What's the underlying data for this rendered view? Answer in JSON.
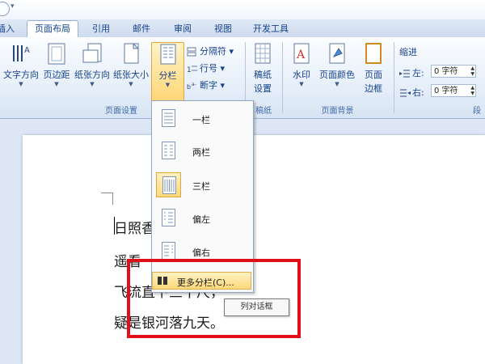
{
  "ribbon_tabs": [
    {
      "label": "插入",
      "active": false
    },
    {
      "label": "页面布局",
      "active": true
    },
    {
      "label": "引用",
      "active": false
    },
    {
      "label": "邮件",
      "active": false
    },
    {
      "label": "审阅",
      "active": false
    },
    {
      "label": "视图",
      "active": false
    },
    {
      "label": "开发工具",
      "active": false
    }
  ],
  "page_setup": {
    "text_direction": "文字方向",
    "margins": "页边距",
    "orientation": "纸张方向",
    "size": "纸张大小",
    "columns": "分栏",
    "breaks": "分隔符",
    "line_numbers": "行号",
    "hyphenation": "断字",
    "group_label": "页面设置"
  },
  "draft": {
    "label_line1": "稿纸",
    "label_line2": "设置",
    "group_label": "稿纸"
  },
  "page_background": {
    "watermark": "水印",
    "page_color": "页面颜色",
    "page_borders_line1": "页面",
    "page_borders_line2": "边框",
    "group_label": "页面背景"
  },
  "indent": {
    "title": "缩进",
    "left_label": "左:",
    "left_value": "0 字符",
    "right_label": "右:",
    "right_value": "0 字符",
    "group_label_partial": "段"
  },
  "columns_menu": {
    "items": [
      {
        "label": "一栏",
        "selected": false
      },
      {
        "label": "两栏",
        "selected": false
      },
      {
        "label": "三栏",
        "selected": true
      },
      {
        "label": "偏左",
        "selected": false
      },
      {
        "label": "偏右",
        "selected": false
      }
    ],
    "more_columns": "更多分栏(C)..."
  },
  "tooltip": "列对话框",
  "document": {
    "lines": [
      "日照香",
      "遥看",
      "飞流直下三千尺，",
      "疑是银河落九天。"
    ]
  },
  "colors": {
    "highlight": "#e0101a",
    "accent": "#15428b",
    "selected_fill": "#ffd676"
  }
}
